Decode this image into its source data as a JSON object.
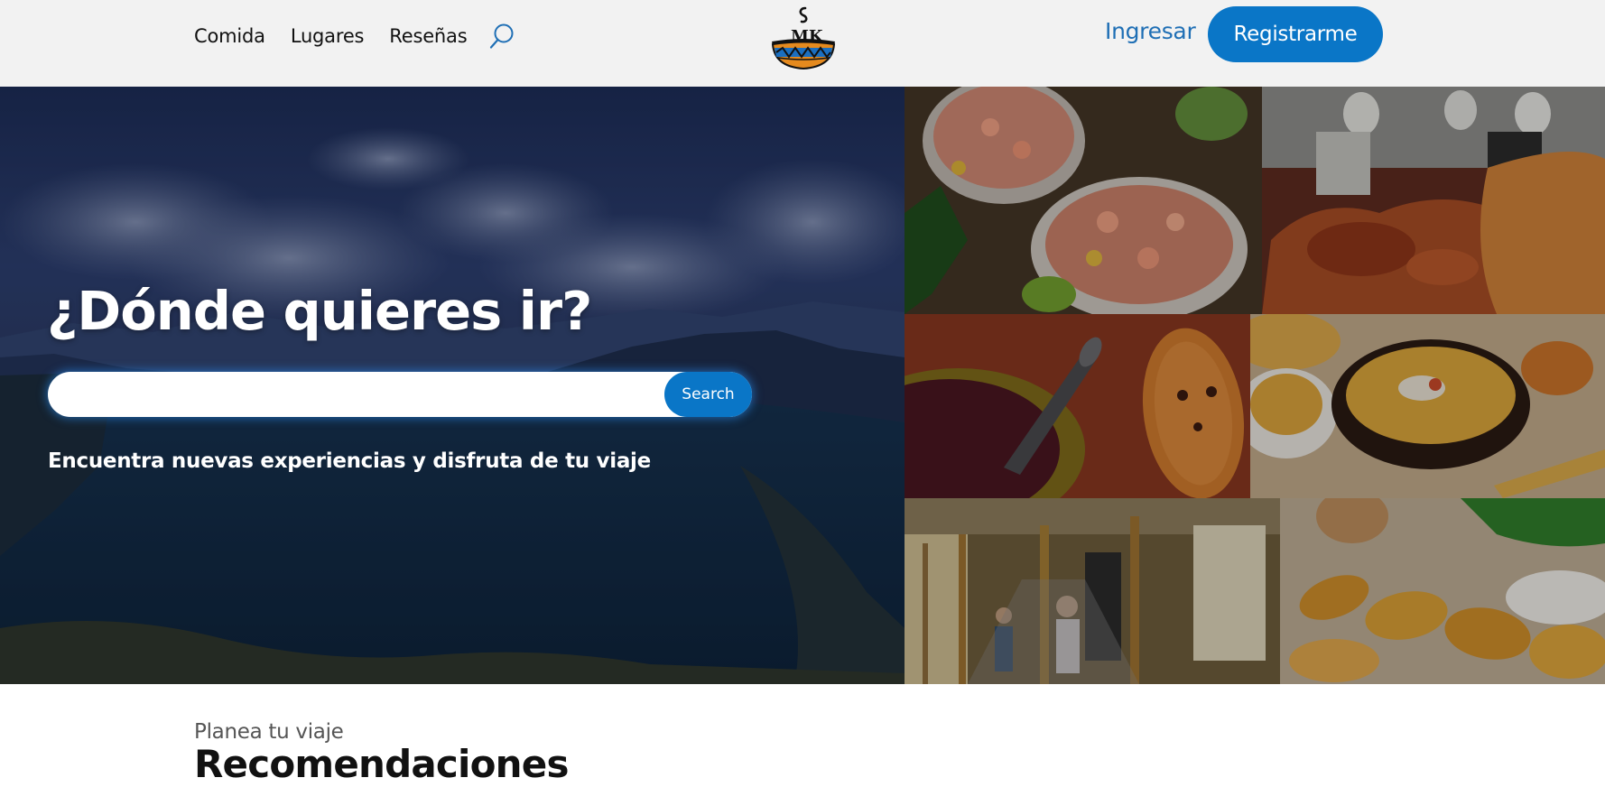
{
  "nav": {
    "links": [
      {
        "label": "Comida"
      },
      {
        "label": "Lugares"
      },
      {
        "label": "Reseñas"
      }
    ],
    "search_icon": "search-icon",
    "logo_icon": "smk-bowl-logo",
    "login_label": "Ingresar",
    "register_label": "Registrarme"
  },
  "hero": {
    "title": "¿Dónde quieres ir?",
    "search": {
      "value": "",
      "placeholder": "",
      "button_label": "Search"
    },
    "subtitle": "Encuentra nuevas experiencias y disfruta de tu viaje"
  },
  "gallery": {
    "images": [
      "shrimp-ceviche-photo",
      "roast-pork-buffet-photo",
      "colada-morada-guagua-de-pan-photo",
      "soup-bowl-photo",
      "handicraft-market-photo",
      "empanadas-photo"
    ]
  },
  "recommendations": {
    "eyebrow": "Planea tu viaje",
    "title": "Recomendaciones"
  },
  "colors": {
    "accent": "#0a76c7",
    "link": "#1f6fb5",
    "navbar_bg": "#f2f2f2"
  }
}
